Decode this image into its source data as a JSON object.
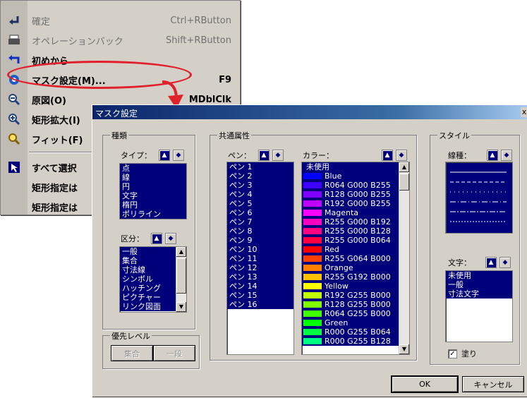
{
  "menu": {
    "items": [
      {
        "label": "確定",
        "shortcut": "Ctrl+RButton",
        "icon": "return-arrow-icon",
        "disabled": true
      },
      {
        "label": "オペレーションバック",
        "shortcut": "Shift+RButton",
        "icon": "printer-icon",
        "disabled": true
      },
      {
        "label": "初めから",
        "shortcut": "",
        "icon": "undo-arrow-icon",
        "disabled": false
      },
      {
        "label": "マスク設定(M)...",
        "shortcut": "F9",
        "icon": "mask-settings-icon",
        "disabled": false
      },
      {
        "label": "原図(O)",
        "shortcut": "MDblClk",
        "icon": "zoom-original-icon",
        "disabled": false
      },
      {
        "label": "矩形拡大(I)",
        "shortcut": "",
        "icon": "zoom-in-icon",
        "disabled": false
      },
      {
        "label": "フィット(F)",
        "shortcut": "",
        "icon": "zoom-fit-icon",
        "disabled": false
      },
      {
        "label": "すべて選択",
        "shortcut": "",
        "icon": "select-all-icon",
        "disabled": false
      },
      {
        "label": "矩形指定は",
        "shortcut": "",
        "icon": "",
        "disabled": false
      },
      {
        "label": "矩形指定は",
        "shortcut": "",
        "icon": "",
        "disabled": false
      }
    ]
  },
  "dialog": {
    "title": "マスク設定",
    "close": "x",
    "groups": {
      "kind": "種類",
      "common": "共通属性",
      "style": "スタイル",
      "priority": "優先レベル"
    },
    "type_header": "タイプ：",
    "type_items": [
      "点",
      "線",
      "円",
      "文字",
      "楕円",
      "ポリライン"
    ],
    "category_header": "区分：",
    "category_items": [
      "一般",
      "集合",
      "寸法線",
      "シンボル",
      "ハッチング",
      "ピクチャー",
      "リンク図面"
    ],
    "pen_header": "ペン：",
    "pen_items": [
      "ペン 1",
      "ペン 2",
      "ペン 3",
      "ペン 4",
      "ペン 5",
      "ペン 6",
      "ペン 7",
      "ペン 8",
      "ペン 9",
      "ペン 10",
      "ペン 11",
      "ペン 12",
      "ペン 13",
      "ペン 14",
      "ペン 15",
      "ペン 16"
    ],
    "color_header": "カラー：",
    "color_items": [
      {
        "label": "未使用",
        "color": ""
      },
      {
        "label": "Blue",
        "color": "#0000ff"
      },
      {
        "label": "R064 G000 B255",
        "color": "#4000ff"
      },
      {
        "label": "R128 G000 B255",
        "color": "#8000ff"
      },
      {
        "label": "R192 G000 B255",
        "color": "#c000ff"
      },
      {
        "label": "Magenta",
        "color": "#ff00ff"
      },
      {
        "label": "R255 G000 B192",
        "color": "#ff00c0"
      },
      {
        "label": "R255 G000 B128",
        "color": "#ff0080"
      },
      {
        "label": "R255 G000 B064",
        "color": "#ff0040"
      },
      {
        "label": "Red",
        "color": "#ff0000"
      },
      {
        "label": "R255 G064 B000",
        "color": "#ff4000"
      },
      {
        "label": "Orange",
        "color": "#ff8000"
      },
      {
        "label": "R255 G192 B000",
        "color": "#ffc000"
      },
      {
        "label": "Yellow",
        "color": "#ffff00"
      },
      {
        "label": "R192 G255 B000",
        "color": "#c0ff00"
      },
      {
        "label": "R128 G255 B000",
        "color": "#80ff00"
      },
      {
        "label": "R064 G255 B000",
        "color": "#40ff00"
      },
      {
        "label": "Green",
        "color": "#00ff00"
      },
      {
        "label": "R000 G255 B064",
        "color": "#00ff40"
      },
      {
        "label": "R000 G255 B128",
        "color": "#00ff80"
      }
    ],
    "linetype_header": "線種：",
    "text_header": "文字：",
    "text_items": [
      "未使用",
      "一般",
      "寸法文字"
    ],
    "fill_label": "塗り",
    "fill_checked": true,
    "priority_buttons": [
      "集合",
      "一段"
    ],
    "ok": "OK",
    "cancel": "キャンセル",
    "selection_color": "#00007b",
    "highlight_color": "#e0202a"
  }
}
